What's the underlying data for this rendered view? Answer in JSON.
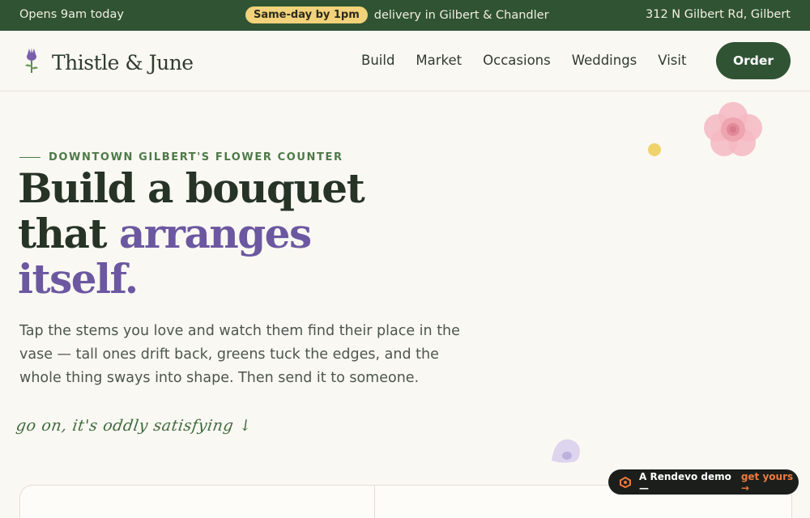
{
  "topbar": {
    "hours": "Opens 9am today",
    "pill": "Same-day by 1pm",
    "delivery": "delivery in Gilbert & Chandler",
    "address": "312 N Gilbert Rd, Gilbert"
  },
  "header": {
    "brand": "Thistle & June",
    "nav": [
      "Build",
      "Market",
      "Occasions",
      "Weddings",
      "Visit"
    ],
    "order_label": "Order"
  },
  "hero": {
    "eyebrow": "DOWNTOWN GILBERT'S FLOWER COUNTER",
    "line1": "Build a bouquet",
    "line2_plain": "that ",
    "line2_accent": "arranges",
    "line3_accent": "itself.",
    "lede": "Tap the stems you love and watch them find their place in the vase — tall ones drift back, greens tuck the edges, and the whole thing sways into shape. Then send it to someone.",
    "scribble": "go on, it's oddly satisfying ↓"
  },
  "badge": {
    "text": "A Rendevo demo —",
    "cta": "get yours →"
  },
  "colors": {
    "brand_green": "#2f5333",
    "accent_purple": "#6b58a0",
    "pill_yellow": "#f2d27a",
    "background": "#faf8f3"
  },
  "icons": [
    "thistle-icon",
    "rose-decoration",
    "pollen-dot",
    "petal-decoration",
    "rendevo-logo-icon"
  ]
}
